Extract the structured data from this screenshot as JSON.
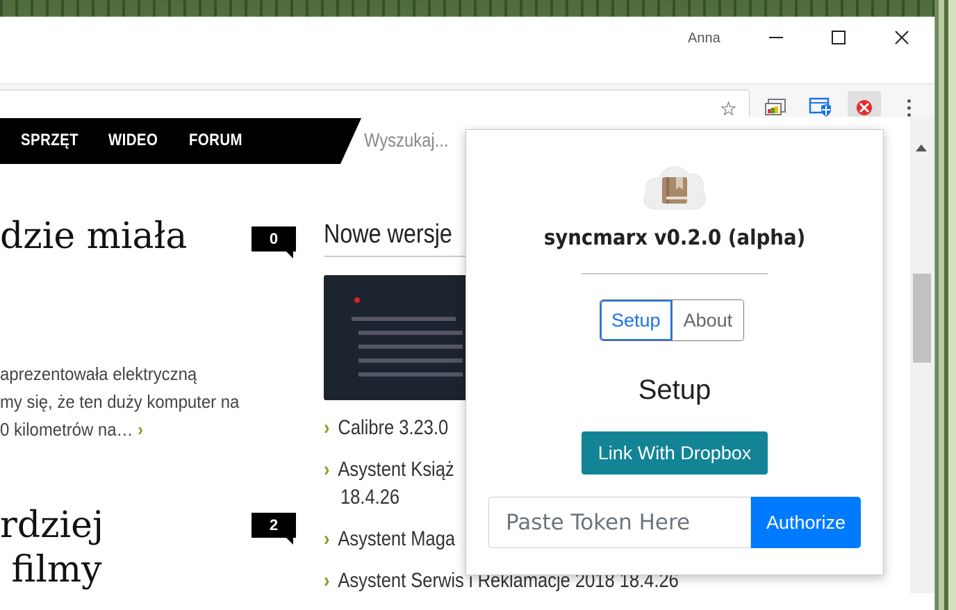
{
  "window": {
    "profile_name": "Anna",
    "minimize_glyph": "—",
    "maximize_glyph": "☐",
    "close_glyph": "✕"
  },
  "toolbar": {
    "bookmark_icon": "star-icon",
    "extensions": [
      "cast-icon",
      "shield-grid-icon",
      "syncmarx-error-icon"
    ]
  },
  "page": {
    "nav": [
      "SPRZĘT",
      "WIDEO",
      "FORUM"
    ],
    "search_placeholder": "Wyszukaj...",
    "articles": [
      {
        "title": "dzie miała",
        "comments": "0"
      },
      {
        "title_line1": "rdziej",
        "title_line2": " filmy",
        "comments": "2"
      }
    ],
    "excerpt": [
      "aprezentowała elektryczną",
      "my się, że ten duży komputer na",
      "0 kilometrów na…"
    ],
    "excerpt_more": "›",
    "sidebar": {
      "heading": "Nowe wersje",
      "items": [
        "Calibre 3.23.0",
        "Asystent Książ",
        "18.4.26",
        "Asystent Maga",
        "Asystent Serwis i Reklamacje 2018 18.4.26"
      ]
    }
  },
  "popup": {
    "title": "syncmarx v0.2.0 (alpha)",
    "tabs": [
      "Setup",
      "About"
    ],
    "active_tab": "Setup",
    "section_heading": "Setup",
    "link_button": "Link With Dropbox",
    "token_placeholder": "Paste Token Here",
    "authorize_button": "Authorize",
    "colors": {
      "primary": "#007bff",
      "info": "#138496"
    }
  }
}
